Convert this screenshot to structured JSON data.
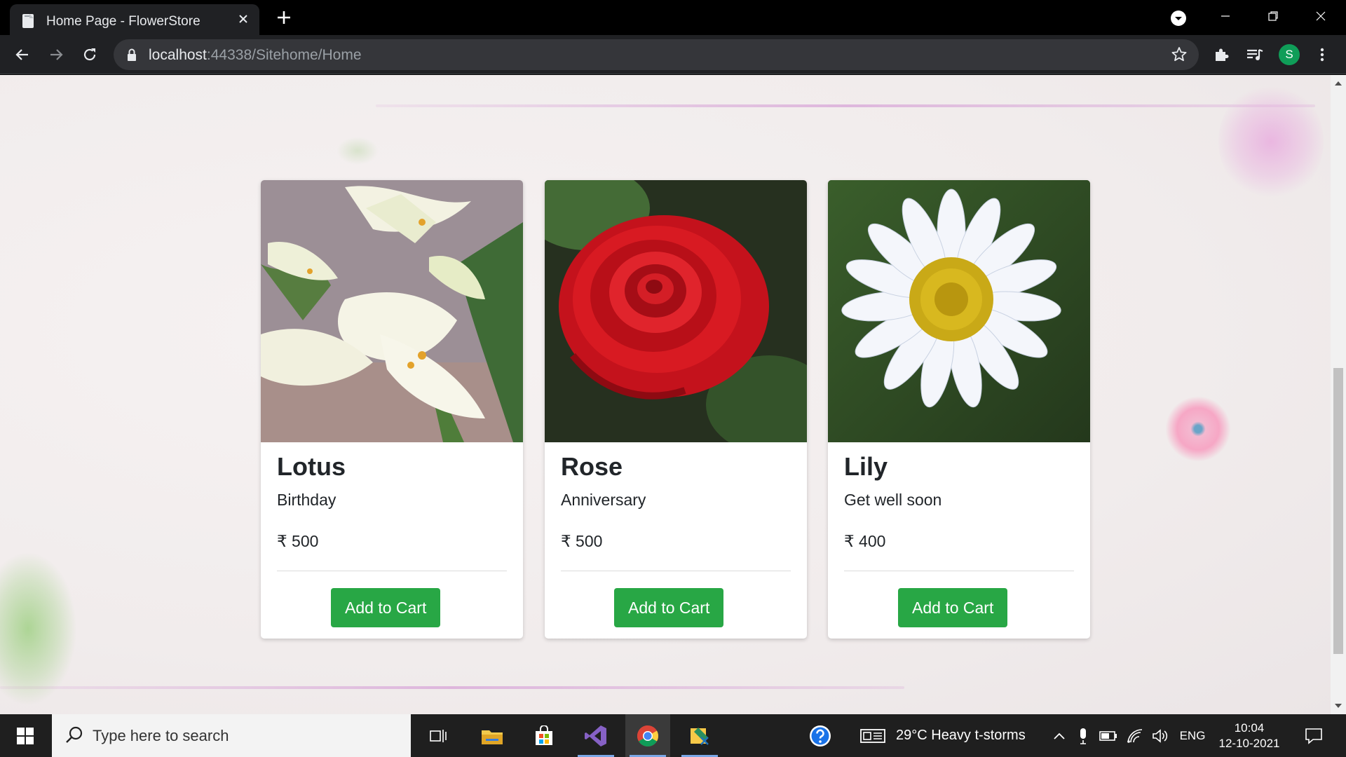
{
  "browser": {
    "tab_title": "Home Page - FlowerStore",
    "url_host": "localhost",
    "url_rest": ":44338/Sitehome/Home",
    "profile_initial": "S"
  },
  "products": [
    {
      "name": "Lotus",
      "occasion": "Birthday",
      "price": "₹ 500",
      "button": "Add to Cart",
      "image": "white-lily-photo"
    },
    {
      "name": "Rose",
      "occasion": "Anniversary",
      "price": "₹ 500",
      "button": "Add to Cart",
      "image": "red-rose-photo"
    },
    {
      "name": "Lily",
      "occasion": "Get well soon",
      "price": "₹ 400",
      "button": "Add to Cart",
      "image": "white-daisy-photo"
    }
  ],
  "taskbar": {
    "search_placeholder": "Type here to search",
    "weather": "29°C  Heavy t-storms",
    "language": "ENG",
    "time": "10:04",
    "date": "12-10-2021"
  },
  "colors": {
    "button_green": "#28a745",
    "chrome_dark": "#202124"
  }
}
